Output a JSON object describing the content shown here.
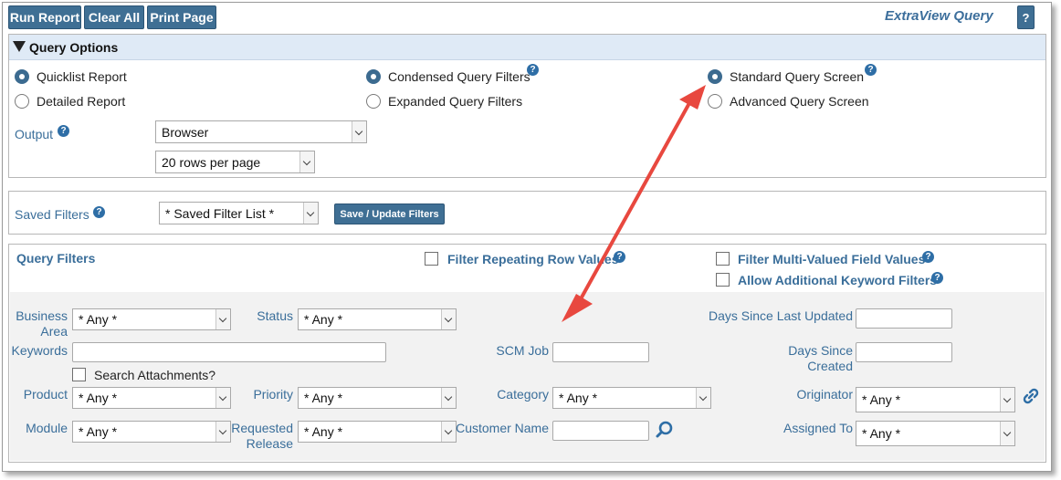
{
  "toolbar": {
    "run_report": "Run Report",
    "clear_all": "Clear All",
    "print_page": "Print Page",
    "app_title": "ExtraView Query",
    "help_label": "?"
  },
  "query_options": {
    "title": "Query Options",
    "report_type": [
      {
        "label": "Quicklist Report",
        "selected": true
      },
      {
        "label": "Detailed Report",
        "selected": false
      }
    ],
    "filter_mode": [
      {
        "label": "Condensed Query Filters",
        "selected": true
      },
      {
        "label": "Expanded Query Filters",
        "selected": false
      }
    ],
    "screen_mode": [
      {
        "label": "Standard Query Screen",
        "selected": true
      },
      {
        "label": "Advanced Query Screen",
        "selected": false
      }
    ],
    "output_label": "Output",
    "output_value": "Browser",
    "rows_value": "20 rows per page"
  },
  "saved_filters": {
    "label": "Saved Filters",
    "value": "* Saved Filter List *",
    "save_button": "Save / Update Filters"
  },
  "query_filters": {
    "title": "Query Filters",
    "filter_repeating": "Filter Repeating Row Values",
    "filter_multi": "Filter Multi-Valued Field Values",
    "allow_keyword": "Allow Additional Keyword Filters",
    "business_area_label": "Business Area",
    "business_area_value": "* Any *",
    "status_label": "Status",
    "status_value": "* Any *",
    "days_updated_label": "Days Since Last Updated",
    "keywords_label": "Keywords",
    "scm_job_label": "SCM Job",
    "days_created_label": "Days Since Created",
    "search_attachments": "Search Attachments?",
    "product_label": "Product",
    "product_value": "* Any *",
    "priority_label": "Priority",
    "priority_value": "* Any *",
    "category_label": "Category",
    "category_value": "* Any *",
    "originator_label": "Originator",
    "originator_value": "* Any *",
    "module_label": "Module",
    "module_value": "* Any *",
    "requested_release_label": "Requested Release",
    "requested_release_value": "* Any *",
    "customer_name_label": "Customer Name",
    "assigned_to_label": "Assigned To",
    "assigned_to_value": "* Any *"
  },
  "colors": {
    "button": "#3f6f94",
    "accent_blue": "#3a6e9a",
    "annotation_arrow": "#e8483f"
  }
}
